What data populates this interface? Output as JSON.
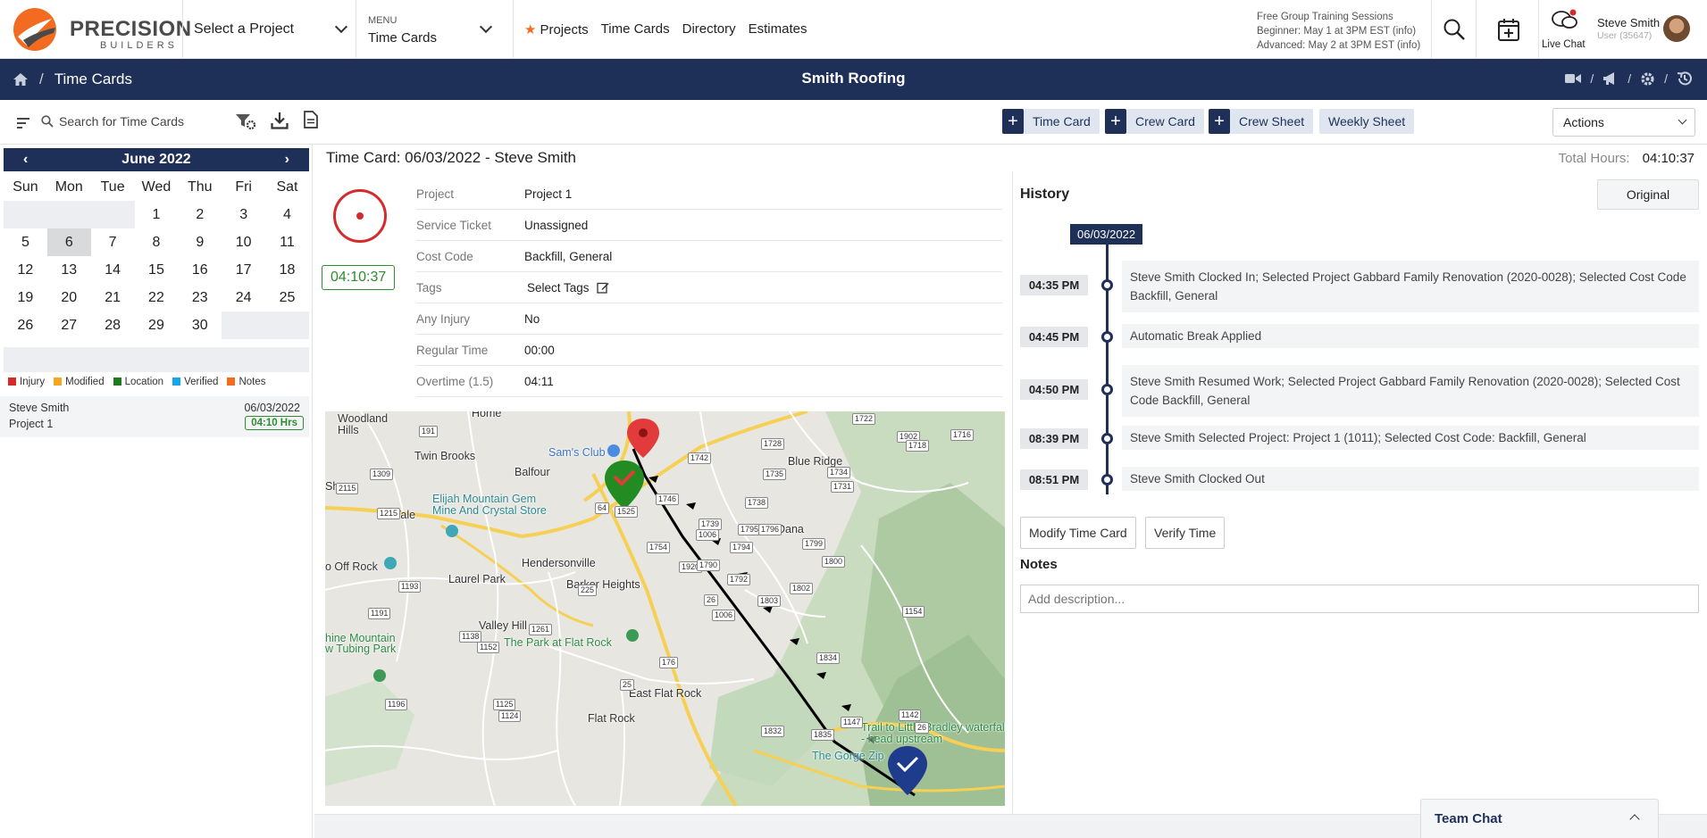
{
  "brand": {
    "name": "PRECISION",
    "sub": "BUILDERS"
  },
  "header": {
    "project_select": "Select a Project",
    "menu_label": "MENU",
    "menu_value": "Time Cards",
    "nav": [
      "Projects",
      "Time Cards",
      "Directory",
      "Estimates"
    ],
    "training": [
      "Free Group Training Sessions",
      "Beginner: May 1 at 3PM EST (info)",
      "Advanced: May 2 at 3PM EST (info)"
    ],
    "live_chat": "Live Chat",
    "user_name": "Steve Smith",
    "user_id": "User (35647)"
  },
  "navbar": {
    "breadcrumb": "Time Cards",
    "title": "Smith Roofing"
  },
  "toolbar": {
    "search_placeholder": "Search for Time Cards",
    "buttons": [
      "Time Card",
      "Crew Card",
      "Crew Sheet"
    ],
    "weekly": "Weekly Sheet",
    "actions": "Actions"
  },
  "calendar": {
    "month": "June 2022",
    "days": [
      "Sun",
      "Mon",
      "Tue",
      "Wed",
      "Thu",
      "Fri",
      "Sat"
    ],
    "weeks": [
      [
        "",
        "",
        "",
        "1",
        "2",
        "3",
        "4"
      ],
      [
        "5",
        "6",
        "7",
        "8",
        "9",
        "10",
        "11"
      ],
      [
        "12",
        "13",
        "14",
        "15",
        "16",
        "17",
        "18"
      ],
      [
        "19",
        "20",
        "21",
        "22",
        "23",
        "24",
        "25"
      ],
      [
        "26",
        "27",
        "28",
        "29",
        "30",
        "",
        ""
      ]
    ],
    "selected": "6"
  },
  "legend": [
    {
      "label": "Injury",
      "color": "#d42c2c"
    },
    {
      "label": "Modified",
      "color": "#f5a623"
    },
    {
      "label": "Location",
      "color": "#1e7a1e"
    },
    {
      "label": "Verified",
      "color": "#1aa3e8"
    },
    {
      "label": "Notes",
      "color": "#f26b21"
    }
  ],
  "entry": {
    "name": "Steve Smith",
    "project": "Project 1",
    "date": "06/03/2022",
    "hours": "04:10 Hrs"
  },
  "timecard": {
    "title": "Time Card: 06/03/2022 - Steve Smith",
    "total_label": "Total Hours:",
    "total_value": "04:10:37",
    "timer": "04:10:37",
    "fields": [
      {
        "k": "Project",
        "v": "Project 1"
      },
      {
        "k": "Service Ticket",
        "v": "Unassigned"
      },
      {
        "k": "Cost Code",
        "v": "Backfill, General"
      },
      {
        "k": "Tags",
        "v": "Select Tags"
      },
      {
        "k": "Any Injury",
        "v": "No"
      },
      {
        "k": "Regular Time",
        "v": "00:00"
      },
      {
        "k": "Overtime (1.5)",
        "v": "04:11"
      }
    ]
  },
  "map": {
    "labels": [
      "Woodland Hills",
      "Twin Brooks",
      "Balfour",
      "Sam's Club",
      "Blue Ridge",
      "Yale",
      "Elijah Mountain Gem Mine And Crystal Store",
      "Hendersonville",
      "Laurel Park",
      "Dana",
      "Barker Heights",
      "Valley Hill",
      "The Park at Flat Rock",
      "East Flat Rock",
      "Flat Rock",
      "Trail to Little Bradley waterfall - head upstream",
      "The Gorge Zip",
      "Home",
      "Shoe",
      "o Off Rock",
      "hine Mountain",
      "w Tubing Park"
    ],
    "roads": [
      "191",
      "1722",
      "1902",
      "1716",
      "1728",
      "1718",
      "1742",
      "1735",
      "1734",
      "1309",
      "2115",
      "1731",
      "1746",
      "1738",
      "1215",
      "64",
      "1525",
      "1739",
      "1006",
      "1795",
      "1796",
      "1799",
      "1754",
      "1794",
      "1800",
      "1920",
      "1790",
      "1792",
      "1193",
      "225",
      "1802",
      "26",
      "1803",
      "1191",
      "1138",
      "1261",
      "1006",
      "1154",
      "1152",
      "176",
      "1834",
      "25",
      "1196",
      "1125",
      "1124",
      "1147",
      "1142",
      "26",
      "1832",
      "1835"
    ]
  },
  "history": {
    "title": "History",
    "original": "Original",
    "date": "06/03/2022",
    "items": [
      {
        "time": "04:35 PM",
        "text": "Steve Smith Clocked In; Selected Project Gabbard Family Renovation (2020-0028); Selected Cost Code Backfill, General"
      },
      {
        "time": "04:45 PM",
        "text": "Automatic Break Applied"
      },
      {
        "time": "04:50 PM",
        "text": "Steve Smith Resumed Work; Selected Project Gabbard Family Renovation (2020-0028); Selected Cost Code Backfill, General"
      },
      {
        "time": "08:39 PM",
        "text": "Steve Smith Selected Project: Project 1 (1011); Selected Cost Code: Backfill, General"
      },
      {
        "time": "08:51 PM",
        "text": "Steve Smith Clocked Out"
      }
    ],
    "modify": "Modify Time Card",
    "verify": "Verify Time",
    "notes_label": "Notes",
    "notes_placeholder": "Add description..."
  },
  "team_chat": "Team Chat",
  "colors": {
    "navy": "#1f3058",
    "orange": "#f26b21",
    "green": "#2e8b2e",
    "red": "#d42c2c"
  }
}
